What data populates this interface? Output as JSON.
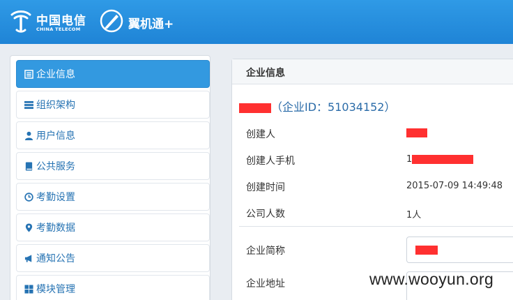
{
  "header": {
    "brand_cn": "中国电信",
    "brand_en": "CHINA TELECOM",
    "app_name": "翼机通+"
  },
  "sidebar": {
    "items": [
      {
        "label": "企业信息",
        "icon": "list-icon",
        "active": true
      },
      {
        "label": "组织架构",
        "icon": "org-icon",
        "active": false
      },
      {
        "label": "用户信息",
        "icon": "user-icon",
        "active": false
      },
      {
        "label": "公共服务",
        "icon": "book-icon",
        "active": false
      },
      {
        "label": "考勤设置",
        "icon": "clock-icon",
        "active": false
      },
      {
        "label": "考勤数据",
        "icon": "map-marker-icon",
        "active": false
      },
      {
        "label": "通知公告",
        "icon": "bullhorn-icon",
        "active": false
      },
      {
        "label": "模块管理",
        "icon": "grid-icon",
        "active": false
      }
    ]
  },
  "panel": {
    "title": "企业信息",
    "company_id_text": "（企业ID：51034152）",
    "rows": [
      {
        "label": "创建人",
        "value": ""
      },
      {
        "label": "创建人手机",
        "value": "1"
      },
      {
        "label": "创建时间",
        "value": "2015-07-09 14:49:48"
      },
      {
        "label": "公司人数",
        "value": "1人"
      }
    ],
    "form": {
      "short_name_label": "企业简称",
      "address_label": "企业地址"
    }
  },
  "watermark": "www.wooyun.org",
  "colors": {
    "header": "#1f84d6",
    "active_item": "#3399e0",
    "link_blue": "#2673b3",
    "redaction": "#ff3030"
  }
}
